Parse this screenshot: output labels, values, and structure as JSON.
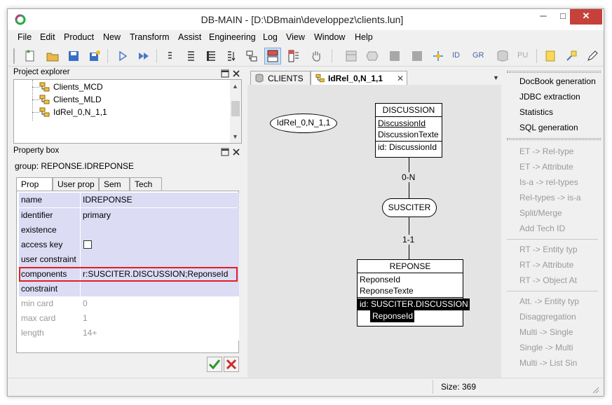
{
  "window": {
    "title": "DB-MAIN - [D:\\DBmain\\developpez\\clients.lun]",
    "minimize_glyph": "─",
    "maximize_glyph": "□",
    "close_glyph": "✕"
  },
  "menubar": {
    "items": [
      "File",
      "Edit",
      "Product",
      "New",
      "Transform",
      "Assist",
      "Engineering",
      "Log",
      "View",
      "Window",
      "Help"
    ]
  },
  "toolbar": {
    "text_items": [
      "ID",
      "GR",
      "PU"
    ]
  },
  "project_explorer": {
    "title": "Project explorer",
    "items": [
      "Clients_MCD",
      "Clients_MLD",
      "IdRel_0,N_1,1"
    ]
  },
  "property_box": {
    "title": "Property box",
    "group_label": "group: REPONSE.IDREPONSE",
    "tabs": [
      "Prop",
      "User prop",
      "Sem",
      "Tech"
    ],
    "rows": [
      {
        "name": "name",
        "value": "IDREPONSE"
      },
      {
        "name": "identifier",
        "value": "primary"
      },
      {
        "name": "existence",
        "value": ""
      },
      {
        "name": "access key",
        "value": ""
      },
      {
        "name": "user constraint",
        "value": ""
      },
      {
        "name": "components",
        "value": "r:SUSCITER.DISCUSSION;ReponseId"
      },
      {
        "name": "constraint",
        "value": ""
      },
      {
        "name": "min card",
        "value": "0"
      },
      {
        "name": "max card",
        "value": "1"
      },
      {
        "name": "length",
        "value": "14+"
      }
    ]
  },
  "editor_tabs": {
    "items": [
      "CLIENTS",
      "IdRel_0,N_1,1"
    ],
    "close_glyph": "✕"
  },
  "diagram": {
    "schema_label": "IdRel_0,N_1,1",
    "discussion": {
      "name": "DISCUSSION",
      "attributes": [
        "DiscussionId",
        "DiscussionTexte"
      ],
      "identifier": "id: DiscussionId"
    },
    "relationship": "SUSCITER",
    "card_top": "0-N",
    "card_bottom": "1-1",
    "reponse": {
      "name": "REPONSE",
      "attributes": [
        "ReponseId",
        "ReponseTexte"
      ],
      "identifier_line1": "id: SUSCITER.DISCUSSION",
      "identifier_line2": "ReponseId"
    }
  },
  "assistant": {
    "top_items": [
      "DocBook generation",
      "JDBC extraction",
      "Statistics",
      "SQL generation"
    ],
    "group1": [
      "ET -> Rel-type",
      "ET -> Attribute",
      "Is-a -> rel-types",
      "Rel-types -> is-a",
      "Split/Merge",
      "Add Tech ID"
    ],
    "group2": [
      "RT -> Entity typ",
      "RT -> Attribute",
      "RT -> Object At"
    ],
    "group3": [
      "Att. -> Entity typ",
      "Disaggregation",
      "Multi -> Single",
      "Single -> Multi",
      "Multi -> List Sin"
    ]
  },
  "status_bar": {
    "size_text": "Size: 369"
  },
  "colors": {
    "property_row_bg": "#dcdcf5",
    "highlight_border": "#e02020",
    "canvas_bg": "#e4e4e4",
    "close_button": "#c7413b"
  }
}
